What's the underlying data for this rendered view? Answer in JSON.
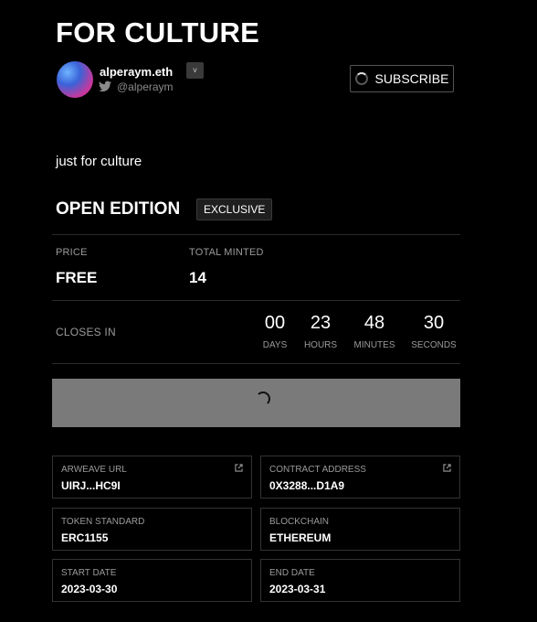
{
  "page": {
    "title": "FOR CULTURE",
    "description": "just for culture"
  },
  "author": {
    "name": "alperaym.eth",
    "handle": "@alperaym",
    "dropdown_glyph": "˅"
  },
  "subscribe": {
    "label": "SUBSCRIBE"
  },
  "edition": {
    "type": "OPEN EDITION",
    "badge": "EXCLUSIVE"
  },
  "stats": {
    "price_label": "PRICE",
    "price_value": "FREE",
    "minted_label": "TOTAL MINTED",
    "minted_value": "14"
  },
  "countdown": {
    "label": "CLOSES IN",
    "units": [
      {
        "value": "00",
        "label": "DAYS"
      },
      {
        "value": "23",
        "label": "HOURS"
      },
      {
        "value": "48",
        "label": "MINUTES"
      },
      {
        "value": "30",
        "label": "SECONDS"
      }
    ]
  },
  "details": [
    {
      "label": "ARWEAVE URL",
      "value": "UIRJ...HC9I",
      "link": true
    },
    {
      "label": "CONTRACT ADDRESS",
      "value": "0X3288...D1A9",
      "link": true
    },
    {
      "label": "TOKEN STANDARD",
      "value": "ERC1155",
      "link": false
    },
    {
      "label": "BLOCKCHAIN",
      "value": "ETHEREUM",
      "link": false
    },
    {
      "label": "START DATE",
      "value": "2023-03-30",
      "link": false
    },
    {
      "label": "END DATE",
      "value": "2023-03-31",
      "link": false
    }
  ],
  "colors": {
    "background": "#000000",
    "mint_area": "#7a7a7a",
    "twitter": "#8a8a8a"
  },
  "icons": {
    "twitter": "twitter-icon",
    "external_link": "external-link-icon",
    "loading": "spinner-icon"
  }
}
